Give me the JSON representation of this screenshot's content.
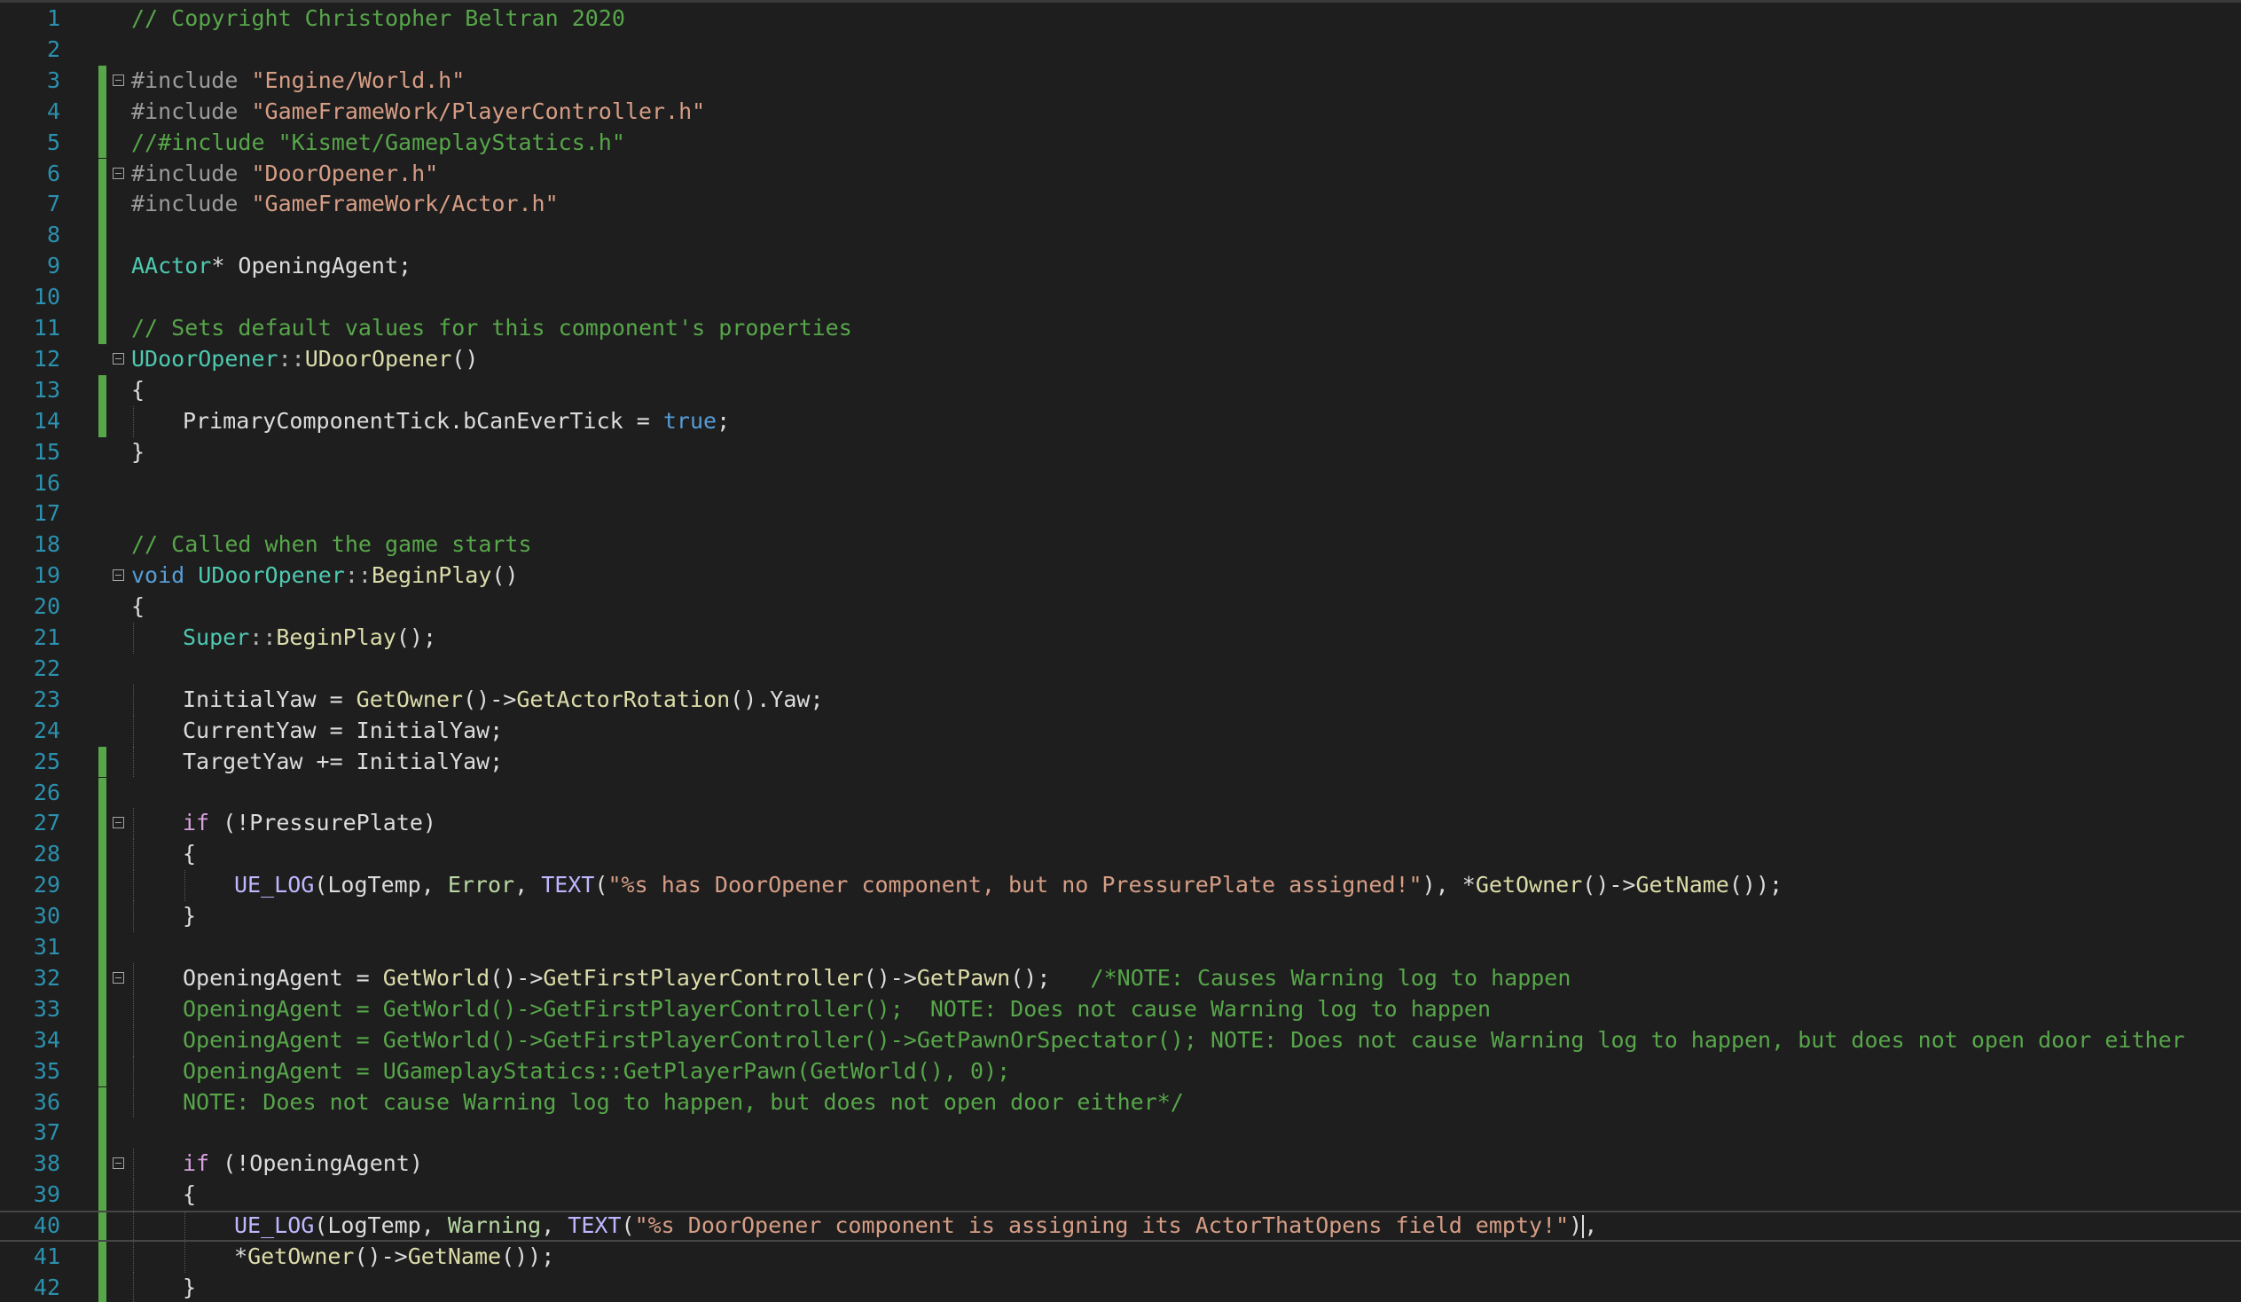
{
  "editor": {
    "colors": {
      "background": "#1e1e1e",
      "line_number": "#2b91af",
      "change_bar": "#57a64a",
      "comment": "#57a64a",
      "string": "#d69d85",
      "keyword": "#569cd6",
      "control_keyword": "#d8a0df",
      "type": "#4ec9b0",
      "function": "#dcdcaa",
      "macro": "#beb7ff",
      "enum": "#b8d7a3",
      "preprocessor": "#9b9b9b",
      "text": "#dcdcdc"
    },
    "lines": [
      {
        "n": "1",
        "changed": false,
        "fold": false,
        "indent": 0,
        "tokens": [
          {
            "t": "comment",
            "v": "// Copyright Christopher Beltran 2020"
          }
        ]
      },
      {
        "n": "2",
        "changed": false,
        "fold": false,
        "indent": 0,
        "tokens": []
      },
      {
        "n": "3",
        "changed": true,
        "fold": true,
        "indent": 0,
        "tokens": [
          {
            "t": "preproc",
            "v": "#include "
          },
          {
            "t": "string",
            "v": "\"Engine/World.h\""
          }
        ]
      },
      {
        "n": "4",
        "changed": true,
        "fold": false,
        "indent": 0,
        "tokens": [
          {
            "t": "preproc",
            "v": "#include "
          },
          {
            "t": "string",
            "v": "\"GameFrameWork/PlayerController.h\""
          }
        ]
      },
      {
        "n": "5",
        "changed": true,
        "fold": false,
        "indent": 0,
        "tokens": [
          {
            "t": "comment",
            "v": "//#include \"Kismet/GameplayStatics.h\""
          }
        ]
      },
      {
        "n": "6",
        "changed": true,
        "fold": true,
        "indent": 0,
        "tokens": [
          {
            "t": "preproc",
            "v": "#include "
          },
          {
            "t": "string",
            "v": "\"DoorOpener.h\""
          }
        ]
      },
      {
        "n": "7",
        "changed": true,
        "fold": false,
        "indent": 0,
        "tokens": [
          {
            "t": "preproc",
            "v": "#include "
          },
          {
            "t": "string",
            "v": "\"GameFrameWork/Actor.h\""
          }
        ]
      },
      {
        "n": "8",
        "changed": true,
        "fold": false,
        "indent": 0,
        "tokens": []
      },
      {
        "n": "9",
        "changed": true,
        "fold": false,
        "indent": 0,
        "tokens": [
          {
            "t": "type",
            "v": "AActor"
          },
          {
            "t": "text",
            "v": "* OpeningAgent;"
          }
        ]
      },
      {
        "n": "10",
        "changed": true,
        "fold": false,
        "indent": 0,
        "tokens": []
      },
      {
        "n": "11",
        "changed": true,
        "fold": false,
        "indent": 0,
        "tokens": [
          {
            "t": "comment",
            "v": "// Sets default values for this component's properties"
          }
        ]
      },
      {
        "n": "12",
        "changed": false,
        "fold": true,
        "indent": 0,
        "tokens": [
          {
            "t": "type",
            "v": "UDoorOpener"
          },
          {
            "t": "op",
            "v": "::"
          },
          {
            "t": "func",
            "v": "UDoorOpener"
          },
          {
            "t": "text",
            "v": "()"
          }
        ]
      },
      {
        "n": "13",
        "changed": true,
        "fold": false,
        "indent": 0,
        "tokens": [
          {
            "t": "text",
            "v": "{"
          }
        ]
      },
      {
        "n": "14",
        "changed": true,
        "fold": false,
        "indent": 1,
        "tokens": [
          {
            "t": "text",
            "v": "PrimaryComponentTick.bCanEverTick = "
          },
          {
            "t": "keyword",
            "v": "true"
          },
          {
            "t": "text",
            "v": ";"
          }
        ]
      },
      {
        "n": "15",
        "changed": false,
        "fold": false,
        "indent": 0,
        "tokens": [
          {
            "t": "text",
            "v": "}"
          }
        ]
      },
      {
        "n": "16",
        "changed": false,
        "fold": false,
        "indent": 0,
        "tokens": []
      },
      {
        "n": "17",
        "changed": false,
        "fold": false,
        "indent": 0,
        "tokens": []
      },
      {
        "n": "18",
        "changed": false,
        "fold": false,
        "indent": 0,
        "tokens": [
          {
            "t": "comment",
            "v": "// Called when the game starts"
          }
        ]
      },
      {
        "n": "19",
        "changed": false,
        "fold": true,
        "indent": 0,
        "tokens": [
          {
            "t": "keyword",
            "v": "void "
          },
          {
            "t": "type",
            "v": "UDoorOpener"
          },
          {
            "t": "op",
            "v": "::"
          },
          {
            "t": "func",
            "v": "BeginPlay"
          },
          {
            "t": "text",
            "v": "()"
          }
        ]
      },
      {
        "n": "20",
        "changed": false,
        "fold": false,
        "indent": 0,
        "tokens": [
          {
            "t": "text",
            "v": "{"
          }
        ]
      },
      {
        "n": "21",
        "changed": false,
        "fold": false,
        "indent": 1,
        "tokens": [
          {
            "t": "type",
            "v": "Super"
          },
          {
            "t": "op",
            "v": "::"
          },
          {
            "t": "func",
            "v": "BeginPlay"
          },
          {
            "t": "text",
            "v": "();"
          }
        ]
      },
      {
        "n": "22",
        "changed": false,
        "fold": false,
        "indent": 0,
        "tokens": []
      },
      {
        "n": "23",
        "changed": false,
        "fold": false,
        "indent": 1,
        "tokens": [
          {
            "t": "text",
            "v": "InitialYaw = "
          },
          {
            "t": "func",
            "v": "GetOwner"
          },
          {
            "t": "text",
            "v": "()->"
          },
          {
            "t": "func",
            "v": "GetActorRotation"
          },
          {
            "t": "text",
            "v": "().Yaw;"
          }
        ]
      },
      {
        "n": "24",
        "changed": false,
        "fold": false,
        "indent": 1,
        "tokens": [
          {
            "t": "text",
            "v": "CurrentYaw = InitialYaw;"
          }
        ]
      },
      {
        "n": "25",
        "changed": true,
        "fold": false,
        "indent": 1,
        "tokens": [
          {
            "t": "text",
            "v": "TargetYaw += InitialYaw;"
          }
        ]
      },
      {
        "n": "26",
        "changed": true,
        "fold": false,
        "indent": 0,
        "tokens": []
      },
      {
        "n": "27",
        "changed": true,
        "fold": true,
        "indent": 1,
        "tokens": [
          {
            "t": "control",
            "v": "if"
          },
          {
            "t": "text",
            "v": " (!PressurePlate)"
          }
        ]
      },
      {
        "n": "28",
        "changed": true,
        "fold": false,
        "indent": 1,
        "tokens": [
          {
            "t": "text",
            "v": "{"
          }
        ]
      },
      {
        "n": "29",
        "changed": true,
        "fold": false,
        "indent": 2,
        "tokens": [
          {
            "t": "macro",
            "v": "UE_LOG"
          },
          {
            "t": "text",
            "v": "(LogTemp, "
          },
          {
            "t": "enum",
            "v": "Error"
          },
          {
            "t": "text",
            "v": ", "
          },
          {
            "t": "macro",
            "v": "TEXT"
          },
          {
            "t": "text",
            "v": "("
          },
          {
            "t": "string",
            "v": "\"%s has DoorOpener component, but no PressurePlate assigned!\""
          },
          {
            "t": "text",
            "v": "), *"
          },
          {
            "t": "func",
            "v": "GetOwner"
          },
          {
            "t": "text",
            "v": "()->"
          },
          {
            "t": "func",
            "v": "GetName"
          },
          {
            "t": "text",
            "v": "());"
          }
        ]
      },
      {
        "n": "30",
        "changed": true,
        "fold": false,
        "indent": 1,
        "tokens": [
          {
            "t": "text",
            "v": "}"
          }
        ]
      },
      {
        "n": "31",
        "changed": true,
        "fold": false,
        "indent": 0,
        "tokens": []
      },
      {
        "n": "32",
        "changed": true,
        "fold": true,
        "indent": 1,
        "tokens": [
          {
            "t": "text",
            "v": "OpeningAgent = "
          },
          {
            "t": "func",
            "v": "GetWorld"
          },
          {
            "t": "text",
            "v": "()->"
          },
          {
            "t": "func",
            "v": "GetFirstPlayerController"
          },
          {
            "t": "text",
            "v": "()->"
          },
          {
            "t": "func",
            "v": "GetPawn"
          },
          {
            "t": "text",
            "v": "();   "
          },
          {
            "t": "comment",
            "v": "/*NOTE: Causes Warning log to happen"
          }
        ]
      },
      {
        "n": "33",
        "changed": true,
        "fold": false,
        "indent": 1,
        "tokens": [
          {
            "t": "comment",
            "v": "OpeningAgent = GetWorld()->GetFirstPlayerController();  NOTE: Does not cause Warning log to happen"
          }
        ]
      },
      {
        "n": "34",
        "changed": true,
        "fold": false,
        "indent": 1,
        "tokens": [
          {
            "t": "comment",
            "v": "OpeningAgent = GetWorld()->GetFirstPlayerController()->GetPawnOrSpectator(); NOTE: Does not cause Warning log to happen, but does not open door either"
          }
        ]
      },
      {
        "n": "35",
        "changed": true,
        "fold": false,
        "indent": 1,
        "tokens": [
          {
            "t": "comment",
            "v": "OpeningAgent = UGameplayStatics::GetPlayerPawn(GetWorld(), 0);"
          }
        ]
      },
      {
        "n": "36",
        "changed": true,
        "fold": false,
        "indent": 1,
        "tokens": [
          {
            "t": "comment",
            "v": "NOTE: Does not cause Warning log to happen, but does not open door either*/"
          }
        ]
      },
      {
        "n": "37",
        "changed": true,
        "fold": false,
        "indent": 0,
        "tokens": []
      },
      {
        "n": "38",
        "changed": true,
        "fold": true,
        "indent": 1,
        "tokens": [
          {
            "t": "control",
            "v": "if"
          },
          {
            "t": "text",
            "v": " (!OpeningAgent)"
          }
        ]
      },
      {
        "n": "39",
        "changed": true,
        "fold": false,
        "indent": 1,
        "tokens": [
          {
            "t": "text",
            "v": "{"
          }
        ]
      },
      {
        "n": "40",
        "changed": true,
        "fold": false,
        "indent": 2,
        "current": true,
        "tokens": [
          {
            "t": "macro",
            "v": "UE_LOG"
          },
          {
            "t": "text",
            "v": "(LogTemp, "
          },
          {
            "t": "enum",
            "v": "Warning"
          },
          {
            "t": "text",
            "v": ", "
          },
          {
            "t": "macro",
            "v": "TEXT"
          },
          {
            "t": "text",
            "v": "("
          },
          {
            "t": "string",
            "v": "\"%s DoorOpener component is assigning its ActorThatOpens field empty!\""
          },
          {
            "t": "text",
            "v": ")"
          },
          {
            "t": "caret",
            "v": ""
          },
          {
            "t": "text",
            "v": ","
          }
        ]
      },
      {
        "n": "41",
        "changed": true,
        "fold": false,
        "indent": 2,
        "tokens": [
          {
            "t": "text",
            "v": "*"
          },
          {
            "t": "func",
            "v": "GetOwner"
          },
          {
            "t": "text",
            "v": "()->"
          },
          {
            "t": "func",
            "v": "GetName"
          },
          {
            "t": "text",
            "v": "());"
          }
        ]
      },
      {
        "n": "42",
        "changed": true,
        "fold": false,
        "indent": 1,
        "tokens": [
          {
            "t": "text",
            "v": "}"
          }
        ]
      }
    ]
  }
}
